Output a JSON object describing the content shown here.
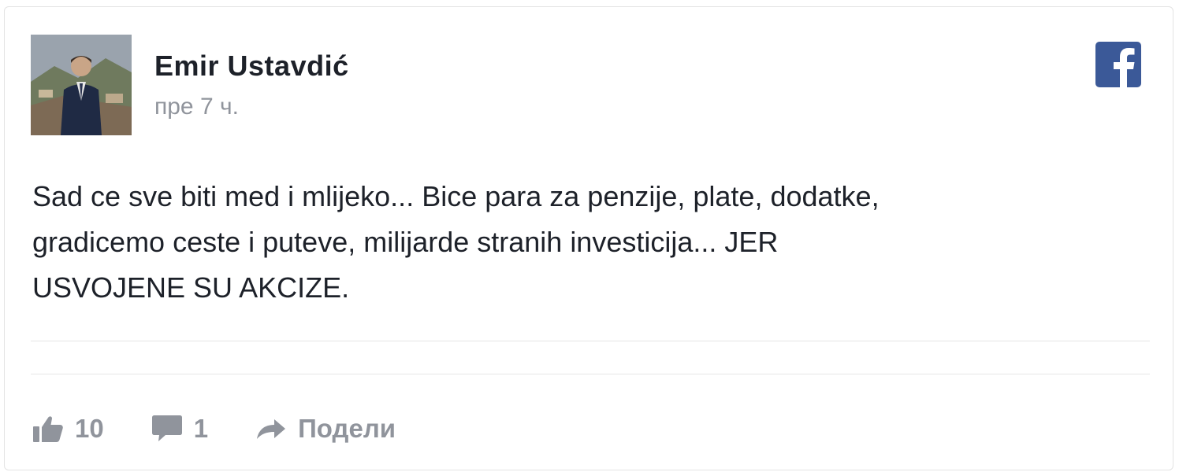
{
  "post": {
    "author": "Emir Ustavdić",
    "time": "пре 7 ч.",
    "text": "Sad ce sve biti med i mlijeko... Bice para za penzije, plate, dodatke,\ngradicemo ceste i puteve, milijarde stranih investicija... JER\nUSVOJENE SU AKCIZE."
  },
  "actions": {
    "likes": "10",
    "comments": "1",
    "share_label": "Подели"
  },
  "icons": {
    "brand": "facebook-icon",
    "like": "thumbs-up-icon",
    "comment": "comment-icon",
    "share": "share-arrow-icon"
  },
  "colors": {
    "brand": "#3b5998",
    "text": "#1d2129",
    "muted": "#90949c"
  }
}
